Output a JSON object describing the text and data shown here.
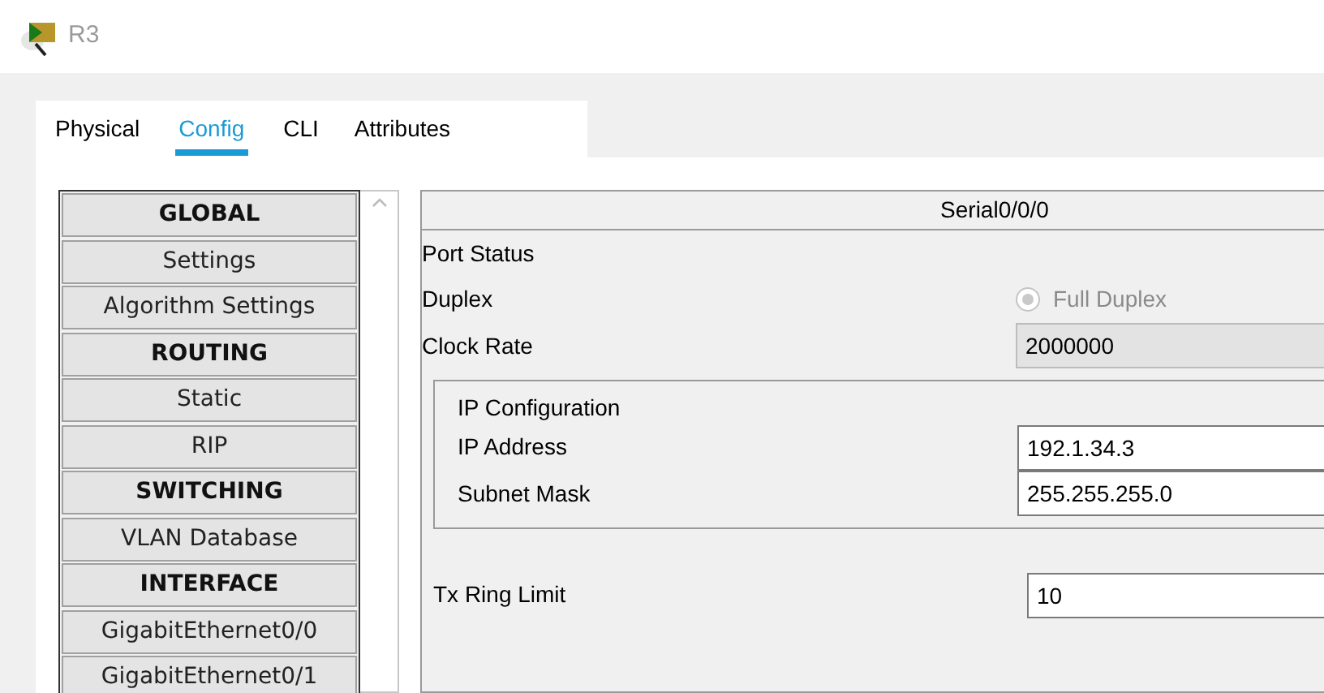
{
  "window": {
    "title": "R3"
  },
  "tabs": [
    {
      "label": "Physical",
      "selected": false
    },
    {
      "label": "Config",
      "selected": true
    },
    {
      "label": "CLI",
      "selected": false
    },
    {
      "label": "Attributes",
      "selected": false
    }
  ],
  "sidebar": {
    "items": [
      {
        "label": "GLOBAL",
        "kind": "header"
      },
      {
        "label": "Settings",
        "kind": "item"
      },
      {
        "label": "Algorithm Settings",
        "kind": "item"
      },
      {
        "label": "ROUTING",
        "kind": "header"
      },
      {
        "label": "Static",
        "kind": "item"
      },
      {
        "label": "RIP",
        "kind": "item"
      },
      {
        "label": "SWITCHING",
        "kind": "header"
      },
      {
        "label": "VLAN Database",
        "kind": "item"
      },
      {
        "label": "INTERFACE",
        "kind": "header"
      },
      {
        "label": "GigabitEthernet0/0",
        "kind": "item"
      },
      {
        "label": "GigabitEthernet0/1",
        "kind": "item"
      }
    ]
  },
  "panel": {
    "title": "Serial0/0/0",
    "rows": [
      {
        "label": "Port Status",
        "kind": "plain"
      },
      {
        "label": "Duplex",
        "kind": "radio",
        "option": "Full Duplex",
        "checked": true,
        "disabled": true
      },
      {
        "label": "Clock Rate",
        "kind": "select",
        "value": "2000000",
        "disabled": true
      }
    ],
    "ip_configuration": {
      "title": "IP Configuration",
      "ip_address": {
        "label": "IP Address",
        "value": "192.1.34.3"
      },
      "subnet_mask": {
        "label": "Subnet Mask",
        "value": "255.255.255.0"
      }
    },
    "tx_ring_limit": {
      "label": "Tx Ring Limit",
      "value": "10"
    }
  }
}
